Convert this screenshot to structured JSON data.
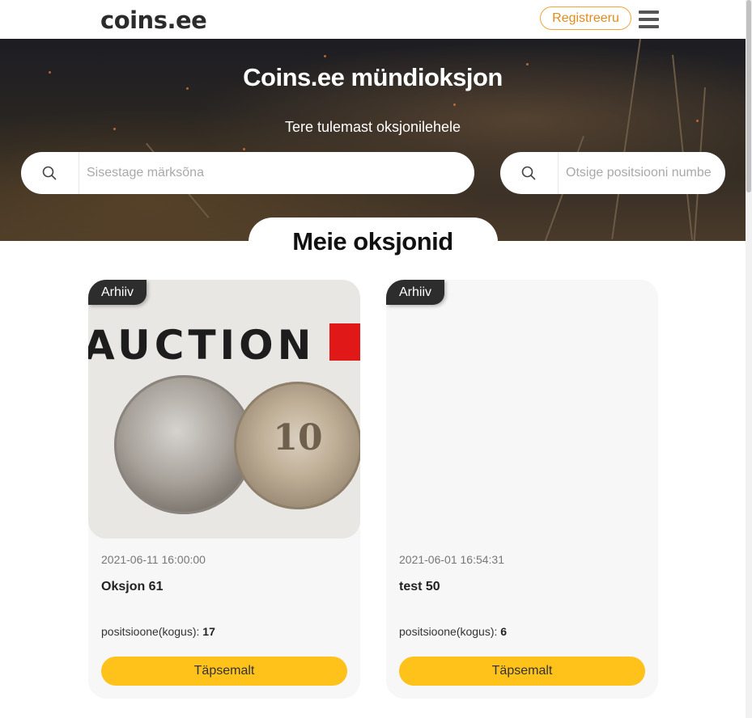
{
  "header": {
    "logo": "coins.ee",
    "register_label": "Registreeru",
    "menu_icon": "hamburger-menu-icon"
  },
  "hero": {
    "title": "Coins.ee mündioksjon",
    "subtitle": "Tere tulemast oksjonilehele",
    "search_keyword": {
      "placeholder": "Sisestage märksõna",
      "value": ""
    },
    "search_position": {
      "placeholder": "Otsige positsiooni numbe",
      "value": ""
    }
  },
  "section": {
    "title": "Meie oksjonid"
  },
  "auctions": [
    {
      "badge": "Arhiiv",
      "date": "2021-06-11 16:00:00",
      "name": "Oksjon 61",
      "count_label": "positsioone(kogus):",
      "count": "17",
      "button": "Täpsemalt",
      "image_text": "AUCTION"
    },
    {
      "badge": "Arhiiv",
      "date": "2021-06-01 16:54:31",
      "name": "test 50",
      "count_label": "positsioone(kogus):",
      "count": "6",
      "button": "Täpsemalt"
    }
  ],
  "colors": {
    "accent_button": "#ffc21a",
    "register_border": "#f0a63a",
    "badge_bg": "#2d2d2d"
  }
}
